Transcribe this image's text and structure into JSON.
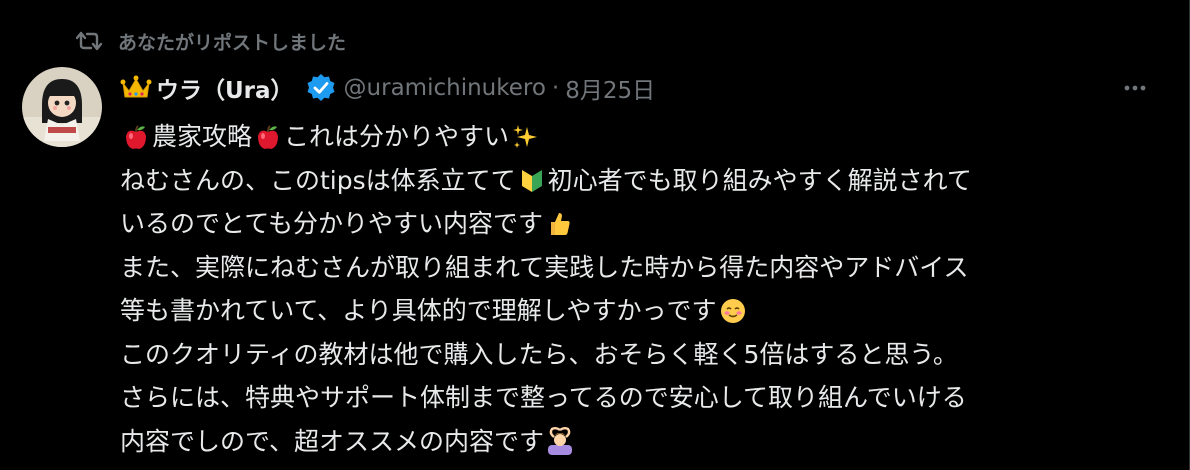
{
  "repost": {
    "text": "あなたがリポストしました",
    "icon": "repost-icon"
  },
  "author": {
    "display_name": "ウラ（Ura）",
    "handle": "@uramichinukero",
    "separator": "·",
    "date": "8月25日",
    "verified_color": "#1d9bf0"
  },
  "tweet": {
    "lines": [
      "農家攻略",
      "これは分かりやすい",
      "ねむさんの、このtipsは体系立てて",
      "初心者でも取り組みやすく解説されて",
      "いるのでとても分かりやすい内容です",
      "また、実際にねむさんが取り組まれて実践した時から得た内容やアドバイス",
      "等も書かれていて、より具体的で理解しやすかっです",
      "このクオリティの教材は他で購入したら、おそらく軽く5倍はすると思う。",
      "さらには、特典やサポート体制まで整ってるので安心して取り組んでいける",
      "内容でしので、超オススメの内容です"
    ]
  },
  "colors": {
    "background": "#000000",
    "text": "#e7e9ea",
    "muted": "#71767b"
  }
}
